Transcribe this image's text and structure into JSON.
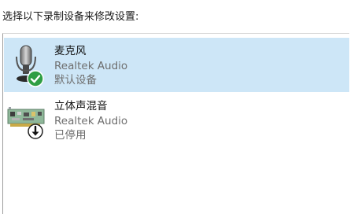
{
  "dialog": {
    "instruction": "选择以下录制设备来修改设置:"
  },
  "devices": [
    {
      "name": "麦克风",
      "driver": "Realtek Audio",
      "status": "默认设备",
      "icon": "microphone-icon",
      "badge": "check-badge",
      "selected": true
    },
    {
      "name": "立体声混音",
      "driver": "Realtek Audio",
      "status": "已停用",
      "icon": "sound-card-icon",
      "badge": "disabled-down-arrow-badge",
      "selected": false
    }
  ],
  "colors": {
    "selection": "#cde6f7",
    "check_badge": "#2f9e44",
    "disabled_badge": "#000000"
  }
}
